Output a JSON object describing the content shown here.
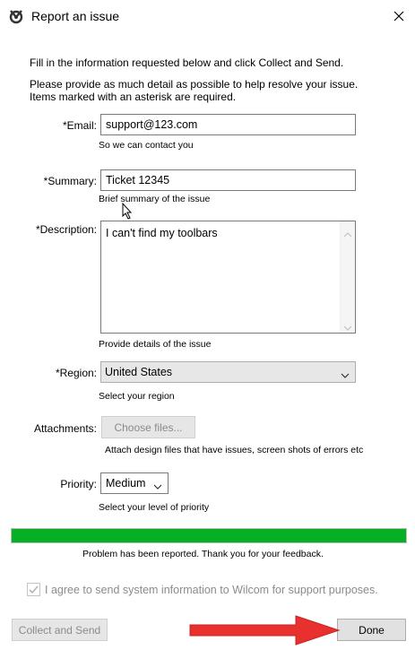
{
  "window": {
    "title": "Report an issue"
  },
  "intro": {
    "line1": "Fill in the information requested below and click Collect and Send.",
    "line2": "Please provide as much detail as possible to help resolve your issue.",
    "line3": "Items marked with an asterisk are required."
  },
  "form": {
    "email": {
      "label": "*Email:",
      "value": "support@123.com",
      "hint": "So we can contact you"
    },
    "summary": {
      "label": "*Summary:",
      "value": "Ticket 12345",
      "hint": "Brief summary of the issue"
    },
    "description": {
      "label": "*Description:",
      "value": "I can't find my toolbars",
      "hint": "Provide details of the issue"
    },
    "region": {
      "label": "*Region:",
      "value": "United States",
      "hint": "Select your region"
    },
    "attachments": {
      "label": "Attachments:",
      "button": "Choose files...",
      "hint": "Attach design files that have issues, screen shots of errors etc"
    },
    "priority": {
      "label": "Priority:",
      "value": "Medium",
      "hint": "Select your level of priority"
    }
  },
  "progress": {
    "percent": 100,
    "color": "#06b025",
    "message": "Problem has been reported. Thank you for your feedback."
  },
  "consent": {
    "label": "I agree to send system information to Wilcom for support purposes.",
    "checked": true
  },
  "buttons": {
    "collect": "Collect and Send",
    "done": "Done"
  },
  "annotation": {
    "arrow_color": "#e8312f"
  }
}
